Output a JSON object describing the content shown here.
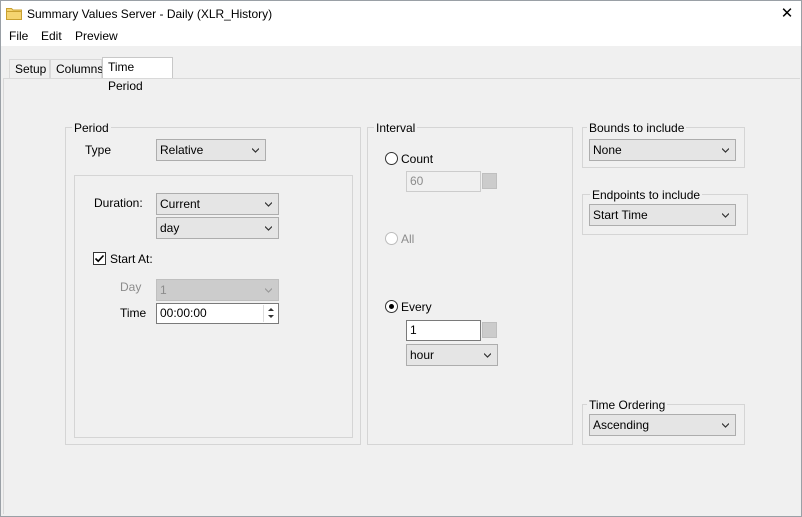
{
  "window": {
    "title": "Summary Values Server - Daily (XLR_History)",
    "close_glyph": "✕"
  },
  "menu": {
    "items": [
      "File",
      "Edit",
      "Preview"
    ]
  },
  "tabs": [
    {
      "label": "Setup",
      "active": false
    },
    {
      "label": "Columns",
      "active": false
    },
    {
      "label": "Time Period",
      "active": true
    }
  ],
  "period": {
    "legend": "Period",
    "type_label": "Type",
    "type_value": "Relative",
    "duration_label": "Duration:",
    "duration_value": "Current",
    "duration_unit": "day",
    "start_at_label": "Start At:",
    "start_at_checked": true,
    "day_label": "Day",
    "day_value": "1",
    "time_label": "Time",
    "time_value": "00:00:00"
  },
  "interval": {
    "legend": "Interval",
    "count_label": "Count",
    "count_value": "60",
    "all_label": "All",
    "every_label": "Every",
    "every_value": "1",
    "every_unit": "hour",
    "selected": "Every"
  },
  "bounds": {
    "legend": "Bounds to include",
    "value": "None"
  },
  "endpoints": {
    "legend": "Endpoints to include",
    "value": "Start Time"
  },
  "ordering": {
    "legend": "Time Ordering",
    "value": "Ascending"
  }
}
